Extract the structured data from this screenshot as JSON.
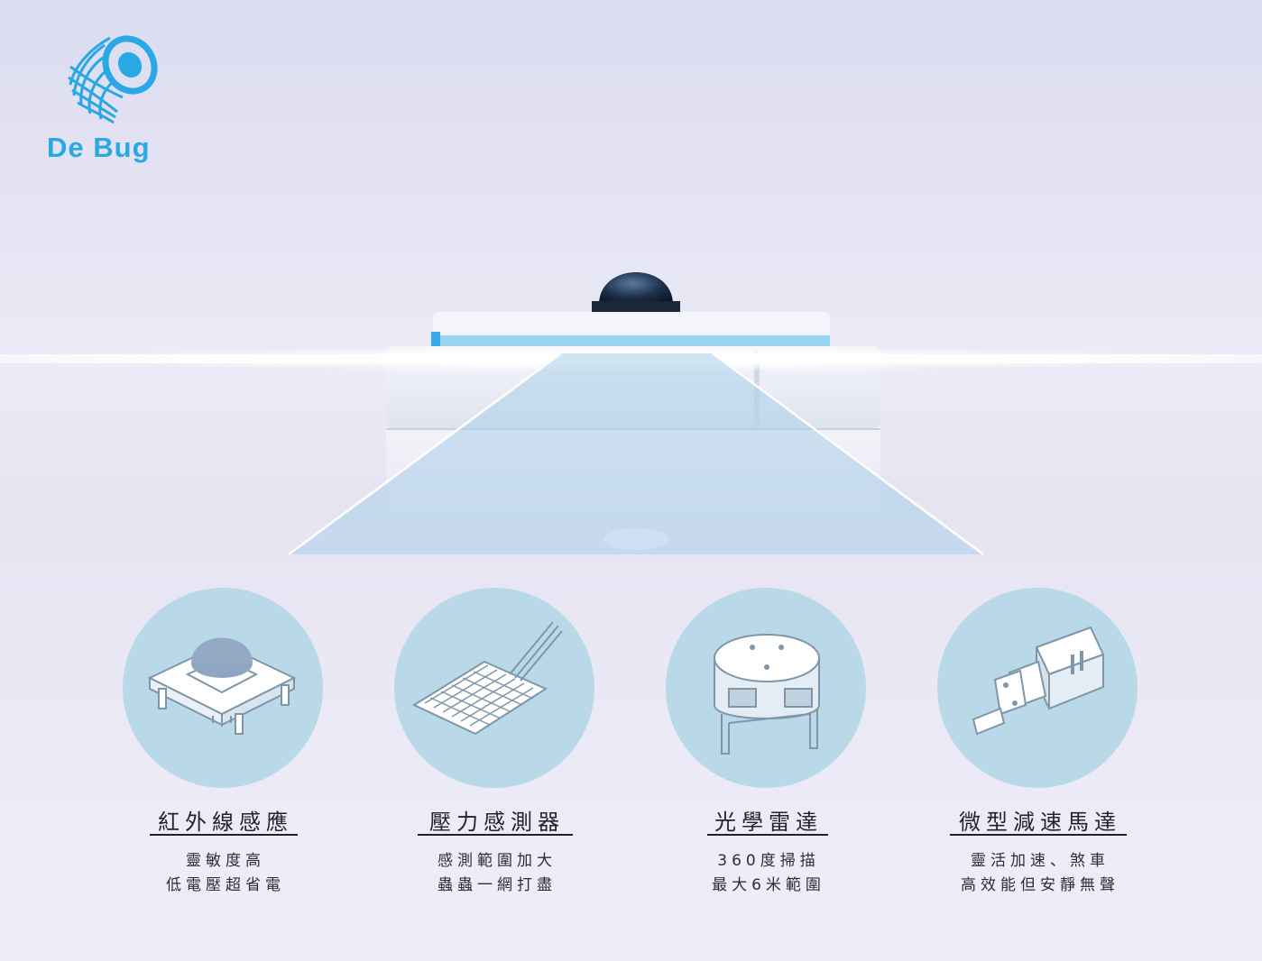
{
  "brand": {
    "name": "De Bug",
    "logo_icon": "debug-bug-logo",
    "color": "#2aa8e6"
  },
  "features": [
    {
      "icon": "infrared-sensor-icon",
      "title": "紅外線感應",
      "line1": "靈敏度高",
      "line2": "低電壓超省電"
    },
    {
      "icon": "pressure-sensor-icon",
      "title": "壓力感測器",
      "line1": "感測範圍加大",
      "line2": "蟲蟲一網打盡"
    },
    {
      "icon": "optical-radar-icon",
      "title": "光學雷達",
      "line1": "360度掃描",
      "line2": "最大6米範圍"
    },
    {
      "icon": "micro-gear-motor-icon",
      "title": "微型減速馬達",
      "line1": "靈活加速、煞車",
      "line2": "高效能但安靜無聲"
    }
  ],
  "colors": {
    "circle": "#b9d9e8",
    "accent": "#2aa8e6",
    "text": "#1f2430"
  }
}
